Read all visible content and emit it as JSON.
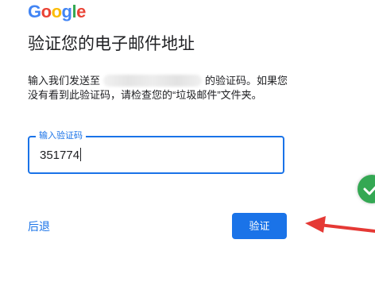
{
  "logo": {
    "letters": [
      "G",
      "o",
      "o",
      "g",
      "l",
      "e"
    ],
    "colors": [
      "#4285F4",
      "#EA4335",
      "#FBBC05",
      "#4285F4",
      "#34A853",
      "#EA4335"
    ]
  },
  "page": {
    "title": "验证您的电子邮件地址",
    "description_prefix": "输入我们发送至",
    "description_suffix": "的验证码。如果您没有看到此验证码，请检查您的“垃圾邮件”文件夹。"
  },
  "code_field": {
    "label": "输入验证码",
    "value": "351774"
  },
  "actions": {
    "back_label": "后退",
    "verify_label": "验证"
  },
  "colors": {
    "accent": "#1a73e8",
    "annotation_arrow": "#e53935",
    "success_badge": "#34a853"
  },
  "icons": {
    "success": "check-icon",
    "annotation": "red-arrow-icon"
  }
}
